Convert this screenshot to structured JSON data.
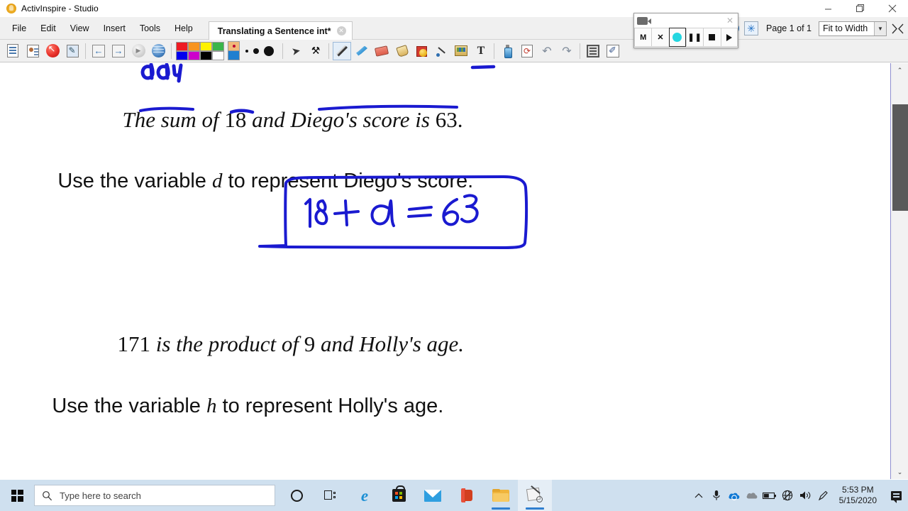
{
  "window": {
    "title": "ActivInspire - Studio",
    "app_icon": "activinspire-hand-icon",
    "controls": {
      "minimize": "–",
      "maximize": "❐",
      "close": "✕"
    }
  },
  "menubar": {
    "items": [
      {
        "label": "File"
      },
      {
        "label": "Edit"
      },
      {
        "label": "View"
      },
      {
        "label": "Insert"
      },
      {
        "label": "Tools"
      },
      {
        "label": "Help"
      }
    ],
    "document_tab": {
      "label": "Translating a Sentence int*",
      "close": "✕"
    },
    "right": {
      "page_label": "Page 1 of 1",
      "zoom_value": "Fit to Width",
      "zoom_caret": "▼"
    }
  },
  "toolbar": {
    "groups": [
      {
        "name": "file",
        "buttons": [
          "new-flipchart-icon",
          "open-flipchart-icon",
          "stop-icon",
          "design-mode-icon"
        ]
      },
      {
        "name": "navigation",
        "buttons": [
          "previous-page-icon",
          "next-page-icon",
          "play-icon",
          "browser-icon"
        ]
      },
      {
        "name": "colors",
        "swatches": [
          "#ee1b23",
          "#f79420",
          "#fff200",
          "#39b54a",
          "#0000ee",
          "#cc00cc",
          "#000000",
          "#ffffff"
        ],
        "current_color": "#f79420",
        "secondary_color": "#1f7fd0"
      },
      {
        "name": "thickness",
        "dots": [
          3,
          6,
          11
        ]
      },
      {
        "name": "tools",
        "buttons": [
          "select-icon",
          "tool-settings-icon",
          "pen-icon",
          "highlighter-icon",
          "eraser-icon",
          "fill-icon",
          "shape-icon",
          "connector-icon",
          "clipart-icon",
          "text-icon"
        ]
      },
      {
        "name": "edit",
        "buttons": [
          "clear-icon",
          "reset-page-icon",
          "undo-icon",
          "redo-icon",
          "page-notes-icon",
          "annotate-desktop-icon"
        ]
      }
    ],
    "selected_tool": "pen-icon"
  },
  "recorder": {
    "title_icon": "camera-icon",
    "close": "✕",
    "buttons": [
      {
        "name": "minimize-button",
        "label": "M"
      },
      {
        "name": "close-button",
        "label": "✕"
      },
      {
        "name": "record-button",
        "label": "●"
      },
      {
        "name": "pause-button",
        "label": "❚❚"
      },
      {
        "name": "stop-button",
        "label": "■"
      },
      {
        "name": "play-button",
        "label": "▶"
      }
    ],
    "active_button": "record-button",
    "record_dot_color": "#24d6e0"
  },
  "flipchart": {
    "lines": [
      {
        "id": "line-1",
        "style": "italic-serif",
        "parts": [
          {
            "text": "The sum of ",
            "kind": "italic"
          },
          {
            "text": "18",
            "kind": "roman"
          },
          {
            "text": " and Diego's score is ",
            "kind": "italic"
          },
          {
            "text": "63.",
            "kind": "roman"
          }
        ],
        "plain": "The sum of 18 and Diego's score is 63."
      },
      {
        "id": "line-2",
        "style": "roman-sans",
        "parts": [
          {
            "text": "Use the variable ",
            "kind": "roman"
          },
          {
            "text": "d",
            "kind": "var"
          },
          {
            "text": " to represent Diego's score.",
            "kind": "roman"
          }
        ],
        "plain": "Use the variable d to represent Diego's score."
      },
      {
        "id": "line-3",
        "style": "italic-serif",
        "parts": [
          {
            "text": "171",
            "kind": "roman"
          },
          {
            "text": " is the product of ",
            "kind": "italic"
          },
          {
            "text": "9",
            "kind": "roman"
          },
          {
            "text": " and Holly's age.",
            "kind": "italic"
          }
        ],
        "plain": "171 is the product of 9 and Holly's age."
      },
      {
        "id": "line-4",
        "style": "roman-sans",
        "parts": [
          {
            "text": "Use the variable ",
            "kind": "roman"
          },
          {
            "text": "h",
            "kind": "var"
          },
          {
            "text": " to represent Holly's age.",
            "kind": "roman"
          }
        ],
        "plain": "Use the variable h to represent Holly's age."
      }
    ],
    "ink": {
      "color": "#1a1ad0",
      "scribble_top": "aay",
      "equation": "18 + d = 63",
      "equation_boxed": true,
      "underlines": [
        "sum",
        "18",
        "Diego's score"
      ]
    }
  },
  "scrollbar": {
    "up_arrow": "⌃",
    "down_arrow": "⌄"
  },
  "taskbar": {
    "start": "windows-logo",
    "search_placeholder": "Type here to search",
    "icons": [
      {
        "name": "cortana-icon"
      },
      {
        "name": "task-view-icon"
      },
      {
        "name": "edge-icon"
      },
      {
        "name": "microsoft-store-icon"
      },
      {
        "name": "mail-icon"
      },
      {
        "name": "office-icon"
      },
      {
        "name": "file-explorer-icon"
      },
      {
        "name": "activinspire-taskbar-icon"
      }
    ],
    "tray": [
      {
        "name": "show-hidden-icons",
        "glyph": "⌃"
      },
      {
        "name": "microphone-icon"
      },
      {
        "name": "onedrive-icon"
      },
      {
        "name": "cloud-icon"
      },
      {
        "name": "battery-icon"
      },
      {
        "name": "network-icon"
      },
      {
        "name": "volume-icon"
      },
      {
        "name": "pen-tray-icon"
      }
    ],
    "clock": {
      "time": "5:53 PM",
      "date": "5/15/2020"
    },
    "notifications": "notification-center-icon"
  }
}
